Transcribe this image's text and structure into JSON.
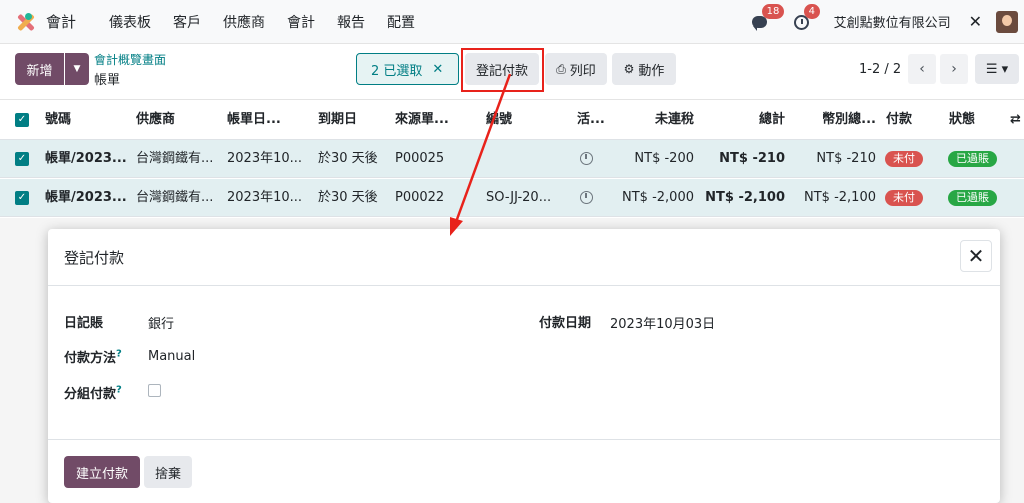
{
  "nav": {
    "app_name": "會計",
    "menu": [
      "儀表板",
      "客戶",
      "供應商",
      "會計",
      "報告",
      "配置"
    ],
    "messages_count": "18",
    "activities_count": "4",
    "company": "艾創點數位有限公司"
  },
  "control": {
    "new_label": "新增",
    "breadcrumb_parent": "會計概覽畫面",
    "breadcrumb_current": "帳單",
    "selected_label": "2 已選取",
    "register_payment_label": "登記付款",
    "print_label": "列印",
    "action_label": "動作",
    "pager": "1-2 / 2"
  },
  "table": {
    "headers": [
      "號碼",
      "供應商",
      "帳單日...",
      "到期日",
      "來源單...",
      "編號",
      "活...",
      "未連稅",
      "總計",
      "幣別總...",
      "付款",
      "狀態"
    ],
    "rows": [
      {
        "number": "帳單/2023...",
        "vendor": "台灣鋼鐵有...",
        "bill_date": "2023年10...",
        "due": "於30 天後",
        "source": "P00025",
        "ref": "",
        "untaxed": "NT$ -200",
        "total": "NT$ -210",
        "currency_total": "NT$ -210",
        "payment": "未付",
        "status": "已過賬"
      },
      {
        "number": "帳單/2023...",
        "vendor": "台灣鋼鐵有...",
        "bill_date": "2023年10...",
        "due": "於30 天後",
        "source": "P00022",
        "ref": "SO-JJ-20...",
        "untaxed": "NT$ -2,000",
        "total": "NT$ -2,100",
        "currency_total": "NT$ -2,100",
        "payment": "未付",
        "status": "已過賬"
      }
    ]
  },
  "dialog": {
    "title": "登記付款",
    "journal_label": "日記賬",
    "journal_value": "銀行",
    "method_label": "付款方法",
    "method_value": "Manual",
    "group_label": "分組付款",
    "help_mark": "?",
    "date_label": "付款日期",
    "date_value": "2023年10月03日",
    "create_label": "建立付款",
    "discard_label": "捨棄"
  },
  "colors": {
    "brand": "#714b67",
    "teal": "#017e84",
    "annotation": "#e8221b"
  }
}
